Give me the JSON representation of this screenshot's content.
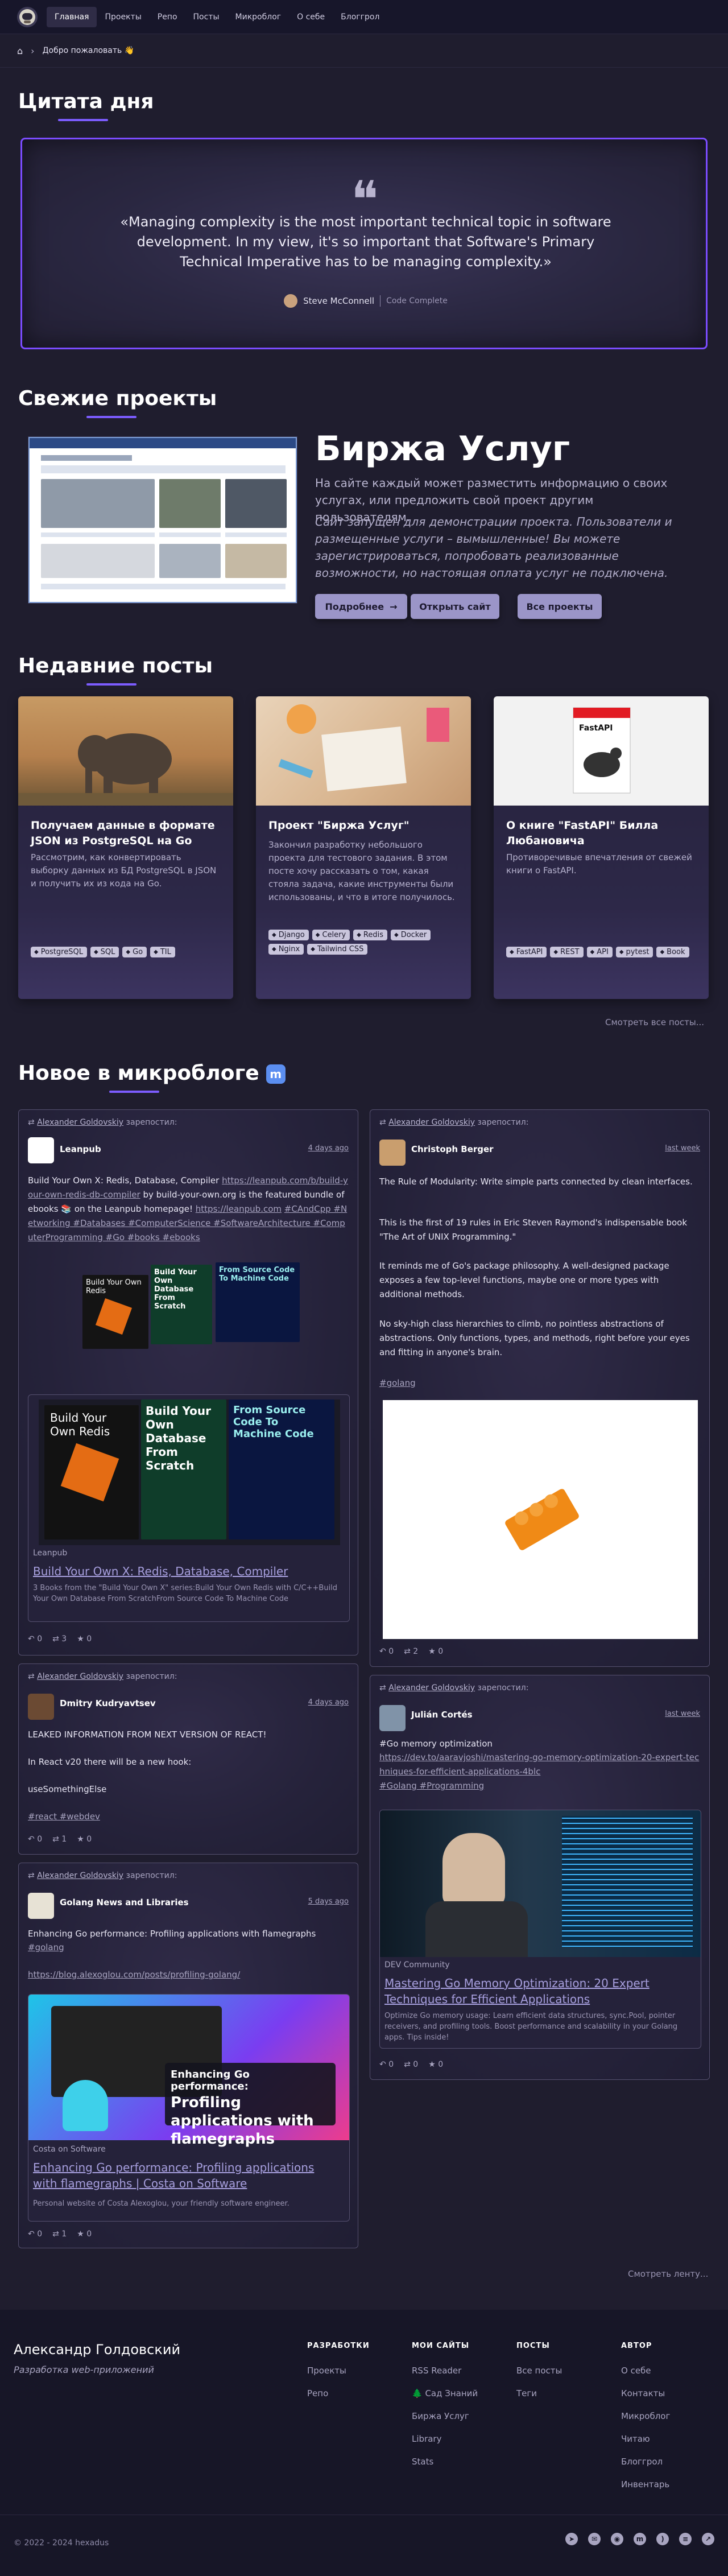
{
  "nav": {
    "items": [
      "Главная",
      "Проекты",
      "Репо",
      "Посты",
      "Микроблог",
      "О себе",
      "Блоггрол"
    ]
  },
  "breadcrumb": {
    "label": "Добро пожаловать 👋"
  },
  "quote": {
    "section_title": "Цитата дня",
    "text": "«Managing complexity is the most important technical topic in software development. In my view, it's so important that Software's Primary Technical Imperative has to be managing complexity.»",
    "author": "Steve McConnell",
    "source": "Code Complete"
  },
  "projects": {
    "section_title": "Свежие проекты",
    "title": "Биржа Услуг",
    "subtitle": "На сайте каждый может разместить информацию о своих услугах, или предложить свой проект другим пользователям.",
    "note": "Сайт запущен для демонстрации проекта. Пользователи и размещенные услуги – вымышленные! Вы можете зарегистрироваться, попробовать реализованные возможности, но настоящая оплата услуг не подключена.",
    "btn_more": "Подробнее",
    "btn_open": "Открыть сайт",
    "btn_all": "Все проекты"
  },
  "posts": {
    "section_title": "Недавние посты",
    "see_all": "Смотреть все посты...",
    "items": [
      {
        "title": "Получаем данные в формате JSON из PostgreSQL на Go",
        "desc": "Рассмотрим, как конвертировать выборку данных из БД PostgreSQL в JSON и получить их из кода на Go.",
        "tags": [
          "PostgreSQL",
          "SQL",
          "Go",
          "TIL"
        ]
      },
      {
        "title": "Проект \"Биржа Услуг\"",
        "desc": "Закончил разработку небольшого проекта для тестового задания. В этом посте хочу рассказать о том, какая стояла задача, какие инструменты были использованы, и что в итоге получилось.",
        "tags": [
          "Django",
          "Celery",
          "Redis",
          "Docker",
          "Nginx",
          "Tailwind CSS"
        ]
      },
      {
        "title": "О книге \"FastAPI\" Билла Любановича",
        "desc": "Противоречивые впечатления от свежей книги о FastAPI.",
        "tags": [
          "FastAPI",
          "REST",
          "API",
          "pytest",
          "Book"
        ]
      }
    ]
  },
  "microblog": {
    "section_title": "Новое в микроблоге",
    "see_more": "Смотреть ленту...",
    "repost_user": "Alexander Goldovskiy",
    "repost_label": "зарепостил:",
    "p1": {
      "name": "Leanpub",
      "time": "4 days ago",
      "text": "Build Your Own X: Redis, Database, Compiler",
      "link1": "https://leanpub.com/b/build-your-own-redis-db-compiler",
      "text2": "by build-your-own.org is the featured bundle of ebooks 📚 on the Leanpub homepage!",
      "link2": "https://leanpub.com",
      "hashtags": "#CAndCpp #Networking #Databases #ComputerScience #SoftwareArchitecture #ComputerProgramming #Go #books #ebooks",
      "cover1": "Build Your Own Redis",
      "cover2": "Build Your Own Database From Scratch",
      "cover3": "From Source Code To Machine Code",
      "card_src": "Leanpub",
      "card_title": "Build Your Own X: Redis, Database, Compiler",
      "card_desc": "3 Books from the \"Build Your Own X\" series:Build Your Own Redis with C/C++Build Your Own Database From ScratchFrom Source Code To Machine Code",
      "stats": [
        "0",
        "3",
        "0"
      ]
    },
    "p2": {
      "name": "Dmitry Kudryavtsev",
      "time": "4 days ago",
      "line1": "LEAKED INFORMATION FROM NEXT VERSION OF REACT!",
      "line2": "In React v20 there will be a new hook:",
      "line3": "useSomethingElse",
      "hashtags": "#react #webdev",
      "stats": [
        "0",
        "1",
        "0"
      ]
    },
    "p3": {
      "name": "Golang News and Libraries",
      "time": "5 days ago",
      "line1": "Enhancing Go performance: Profiling applications with flamegraphs",
      "hashtags": "#golang",
      "link": "https://blog.alexoglou.com/posts/profiling-golang/",
      "img_small": "Enhancing Go performance:",
      "img_big": "Profiling applications with flamegraphs",
      "card_src": "Costa on Software",
      "card_title": "Enhancing Go performance: Profiling applications with flamegraphs | Costa on Software",
      "card_desc": "Personal website of Costa Alexoglou, your friendly software engineer.",
      "stats": [
        "0",
        "1",
        "0"
      ]
    },
    "p4": {
      "name": "Christoph Berger",
      "time": "last week",
      "para1": "The Rule of Modularity: Write simple parts connected by clean interfaces.",
      "para2": "This is the first of 19 rules in Eric Steven Raymond's indispensable book \"The Art of UNIX Programming.\"",
      "para3": "It reminds me of Go's package philosophy. A well-designed package exposes a few top-level functions, maybe one or more types with additional methods.",
      "para4": "No sky-high class hierarchies to climb, no pointless abstractions of abstractions. Only functions, types, and methods, right before your eyes and fitting in anyone's brain.",
      "hashtags": "#golang",
      "stats": [
        "0",
        "2",
        "0"
      ]
    },
    "p5": {
      "name": "Julián Cortés",
      "time": "last week",
      "line1": "#Go memory optimization",
      "link": "https://dev.to/aaravjoshi/mastering-go-memory-optimization-20-expert-techniques-for-efficient-applications-4blc",
      "hashtags": "#Golang #Programming",
      "card_src": "DEV Community",
      "card_title": "Mastering Go Memory Optimization: 20 Expert Techniques for Efficient Applications",
      "card_desc": "Optimize Go memory usage: Learn efficient data structures, sync.Pool, pointer receivers, and profiling tools. Boost performance and scalability in your Golang apps. Tips inside!",
      "stats": [
        "0",
        "0",
        "0"
      ]
    }
  },
  "footer": {
    "name": "Александр Голдовский",
    "role": "Разработка web-приложений",
    "copyright": "© 2022 - 2024 hexadus",
    "cols": [
      {
        "h": "РАЗРАБОТКИ",
        "items": [
          "Проекты",
          "Репо"
        ]
      },
      {
        "h": "МОИ САЙТЫ",
        "items": [
          "RSS Reader",
          "🌲 Сад Знаний",
          "Биржа Услуг",
          "Library",
          "Stats"
        ]
      },
      {
        "h": "ПОСТЫ",
        "items": [
          "Все посты",
          "Теги"
        ]
      },
      {
        "h": "АВТОР",
        "items": [
          "О себе",
          "Контакты",
          "Микроблог",
          "Читаю",
          "Блоггрол",
          "Инвентарь"
        ]
      }
    ]
  },
  "colors": {
    "accent": "#7c5cff",
    "bg": "#1f1d2e",
    "nav": "#17162a",
    "button": "#9b95c8"
  }
}
